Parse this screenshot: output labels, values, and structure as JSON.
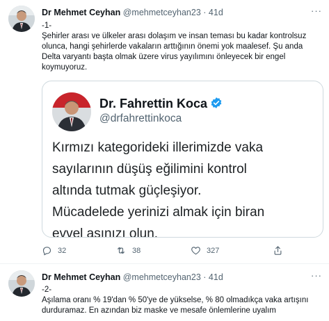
{
  "tweets": [
    {
      "author_name": "Dr Mehmet Ceyhan",
      "handle": "@mehmetceyhan23",
      "separator": "·",
      "age": "41d",
      "more": "···",
      "text_lines": [
        "-1-",
        "Şehirler arası ve ülkeler arası dolaşım ve insan teması bu kadar kontrolsuz",
        "olunca, hangi şehirlerde vakaların arttığının önemi yok maalesef. Şu anda",
        "Delta varyantı başta olmak üzere virus yayılımını önleyecek bir engel",
        "koymuyoruz."
      ],
      "embedded": {
        "name": "Dr. Fahrettin Koca",
        "handle": "@drfahrettinkoca",
        "text_lines": [
          "Kırmızı kategorideki illerimizde vaka",
          "sayılarının düşüş eğilimini kontrol",
          "altında tutmak güçleşiyor.",
          "Mücadelede yerinizi almak için biran",
          "evvel aşınızı olun."
        ]
      },
      "actions": {
        "reply": "32",
        "retweet": "38",
        "like": "327"
      }
    },
    {
      "author_name": "Dr Mehmet Ceyhan",
      "handle": "@mehmetceyhan23",
      "separator": "·",
      "age": "41d",
      "more": "···",
      "text_lines": [
        "-2-",
        "Aşılama oranı % 19'dan % 50'ye de yükselse, % 80 olmadıkça vaka artışını",
        "durduramaz. En azından biz maske ve mesafe önlemlerine uyalım"
      ]
    }
  ],
  "colors": {
    "text": "#0f1419",
    "muted": "#536471",
    "border": "#cfd9de",
    "verified": "#1d9bf0"
  }
}
